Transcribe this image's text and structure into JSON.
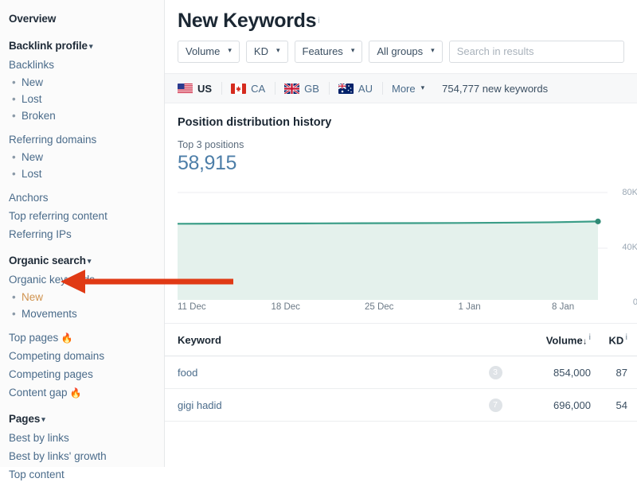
{
  "sidebar": {
    "overview_label": "Overview",
    "groups": [
      {
        "name": "backlink-profile",
        "head": "Backlink profile",
        "caret": "▾",
        "items": [
          {
            "label": "Backlinks",
            "type": "link"
          },
          {
            "label": "New",
            "type": "sub"
          },
          {
            "label": "Lost",
            "type": "sub"
          },
          {
            "label": "Broken",
            "type": "sub"
          },
          {
            "label": "Referring domains",
            "type": "link",
            "gap": true
          },
          {
            "label": "New",
            "type": "sub"
          },
          {
            "label": "Lost",
            "type": "sub"
          },
          {
            "label": "Anchors",
            "type": "link",
            "gap": true
          },
          {
            "label": "Top referring content",
            "type": "link"
          },
          {
            "label": "Referring IPs",
            "type": "link"
          }
        ]
      },
      {
        "name": "organic-search",
        "head": "Organic search",
        "caret": "▾",
        "items": [
          {
            "label": "Organic keywords",
            "type": "link"
          },
          {
            "label": "New",
            "type": "sub",
            "active": true
          },
          {
            "label": "Movements",
            "type": "sub"
          },
          {
            "label": "Top pages",
            "type": "link",
            "flame": true,
            "gap": true
          },
          {
            "label": "Competing domains",
            "type": "link"
          },
          {
            "label": "Competing pages",
            "type": "link"
          },
          {
            "label": "Content gap",
            "type": "link",
            "flame": true
          }
        ]
      },
      {
        "name": "pages",
        "head": "Pages",
        "caret": "▾",
        "items": [
          {
            "label": "Best by links",
            "type": "link"
          },
          {
            "label": "Best by links' growth",
            "type": "link"
          },
          {
            "label": "Top content",
            "type": "link"
          }
        ]
      }
    ],
    "flame_glyph": "🔥"
  },
  "header": {
    "title": "New Keywords",
    "info_glyph": "i"
  },
  "filters": [
    {
      "label": "Volume",
      "caret": "▾",
      "name": "volume"
    },
    {
      "label": "KD",
      "caret": "▾",
      "name": "kd"
    },
    {
      "label": "Features",
      "caret": "▾",
      "name": "features"
    },
    {
      "label": "All groups",
      "caret": "▾",
      "name": "all-groups"
    }
  ],
  "search": {
    "placeholder": "Search in results",
    "value": ""
  },
  "countries": [
    {
      "code": "US",
      "active": true
    },
    {
      "code": "CA",
      "active": false
    },
    {
      "code": "GB",
      "active": false
    },
    {
      "code": "AU",
      "active": false
    }
  ],
  "country_bar": {
    "more_label": "More",
    "more_caret": "▾",
    "count_text": "754,777 new keywords"
  },
  "chart_panel": {
    "title": "Position distribution history",
    "metric_label": "Top 3 positions",
    "metric_value": "58,915",
    "line_color": "#3a9d87",
    "fill_color": "#e4f1ec"
  },
  "chart_data": {
    "type": "area",
    "title": "Position distribution history",
    "xlabel": "",
    "ylabel": "",
    "ylim": [
      0,
      80000
    ],
    "ytick_labels": [
      "80K",
      "40K",
      "0"
    ],
    "ytick_values": [
      80000,
      40000,
      0
    ],
    "grid": true,
    "legend": "none",
    "x": [
      "11 Dec",
      "18 Dec",
      "25 Dec",
      "1 Jan",
      "8 Jan"
    ],
    "xtick_labels": [
      "11 Dec",
      "18 Dec",
      "25 Dec",
      "1 Jan",
      "8 Jan"
    ],
    "series": [
      {
        "name": "Top 3 positions",
        "values": [
          57200,
          57300,
          57400,
          57500,
          57600,
          57700,
          57800,
          58000,
          58300,
          58915
        ],
        "end_point_value": 58915
      }
    ]
  },
  "table": {
    "columns": [
      {
        "key": "keyword",
        "label": "Keyword"
      },
      {
        "key": "position",
        "label": ""
      },
      {
        "key": "volume",
        "label": "Volume",
        "sort": "↓",
        "info": "i"
      },
      {
        "key": "kd",
        "label": "KD",
        "info": "i"
      }
    ],
    "rows": [
      {
        "keyword": "food",
        "position": "3",
        "volume": "854,000",
        "kd": "87"
      },
      {
        "keyword": "gigi hadid",
        "position": "7",
        "volume": "696,000",
        "kd": "54"
      }
    ]
  },
  "annotation": {
    "arrow_color": "#e03a15",
    "target": "sidebar-item-organic-new"
  }
}
